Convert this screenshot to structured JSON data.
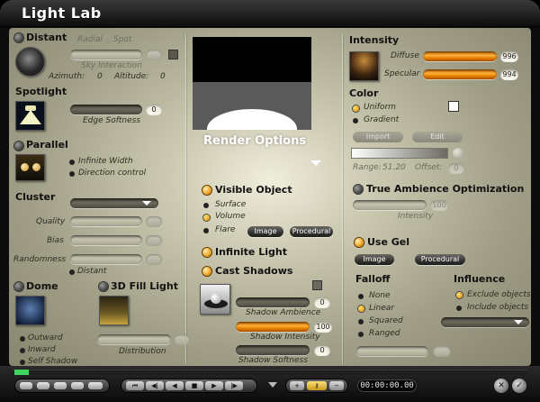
{
  "window": {
    "title": "Light Lab"
  },
  "left": {
    "distant": {
      "header": "Distant",
      "mode_radial": "Radial",
      "mode_spot": "Spot",
      "sky_interaction": "Sky Interaction",
      "azimuth_label": "Azimuth:",
      "azimuth_value": "0",
      "altitude_label": "Altitude:",
      "altitude_value": "0"
    },
    "spotlight": {
      "header": "Spotlight",
      "edge_softness_label": "Edge Softness",
      "edge_softness_value": "0"
    },
    "parallel": {
      "header": "Parallel",
      "infinite_width": "Infinite Width",
      "direction_control": "Direction control"
    },
    "cluster": {
      "header": "Cluster",
      "quality_label": "Quality",
      "bias_label": "Bias",
      "randomness_label": "Randomness",
      "distant_option": "Distant"
    },
    "dome": {
      "header": "Dome",
      "outward": "Outward",
      "inward": "Inward",
      "self_shadow": "Self Shadow"
    },
    "fill_light": {
      "header": "3D Fill Light",
      "distribution_label": "Distribution"
    }
  },
  "center": {
    "render_options_title": "Render Options",
    "visible_object": "Visible Object",
    "surface": "Surface",
    "volume": "Volume",
    "flare": "Flare",
    "image_button": "Image",
    "procedural_button": "Procedural",
    "infinite_light": "Infinite Light",
    "cast_shadows": "Cast Shadows",
    "shadow_ambience_label": "Shadow Ambience",
    "shadow_ambience_value": "0",
    "shadow_intensity_label": "Shadow Intensity",
    "shadow_intensity_value": "100",
    "shadow_softness_label": "Shadow Softness",
    "shadow_softness_value": "0"
  },
  "right": {
    "intensity_header": "Intensity",
    "diffuse_label": "Diffuse",
    "diffuse_value": "996",
    "specular_label": "Specular",
    "specular_value": "994",
    "color_header": "Color",
    "uniform": "Uniform",
    "gradient": "Gradient",
    "import_button": "Import",
    "edit_button": "Edit",
    "range_label": "Range:",
    "range_value": "51.20",
    "offset_label": "Offset:",
    "offset_value": "0",
    "tao_header": "True Ambience Optimization",
    "tao_intensity_label": "Intensity",
    "tao_intensity_value": "100",
    "use_gel": "Use Gel",
    "gel_image_button": "Image",
    "gel_procedural_button": "Procedural",
    "falloff_header": "Falloff",
    "falloff_none": "None",
    "falloff_linear": "Linear",
    "falloff_squared": "Squared",
    "falloff_ranged": "Ranged",
    "influence_header": "Influence",
    "exclude_objects": "Exclude objects",
    "include_objects": "Include objects"
  },
  "footer": {
    "timecode": "00:00:00.00"
  },
  "colors": {
    "accent_orange": "#f0a020",
    "panel": "#bdbba2",
    "frame": "#0c0c0c"
  }
}
